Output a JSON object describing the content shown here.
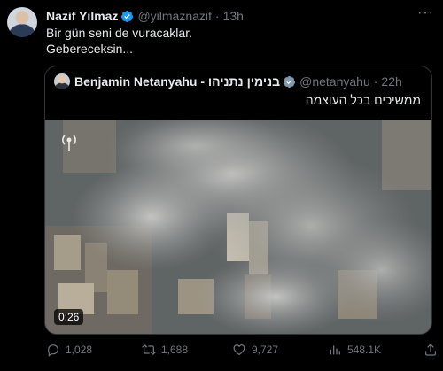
{
  "author": {
    "name": "Nazif Yılmaz",
    "handle": "@yilmaznazif",
    "time": "13h"
  },
  "tweet_text": {
    "line1": "Bir gün seni de vuracaklar.",
    "line2": "Gebereceksin..."
  },
  "quoted": {
    "name": "Benjamin Netanyahu - בנימין נתניהו",
    "handle": "@netanyahu",
    "time": "22h",
    "text": "ממשיכים בכל העוצמה",
    "video_duration": "0:26"
  },
  "stats": {
    "replies": "1,028",
    "retweets": "1,688",
    "likes": "9,727",
    "views": "548.1K"
  },
  "colors": {
    "background": "#000000",
    "muted": "#71767b",
    "verified_blue": "#1d9bf0"
  }
}
